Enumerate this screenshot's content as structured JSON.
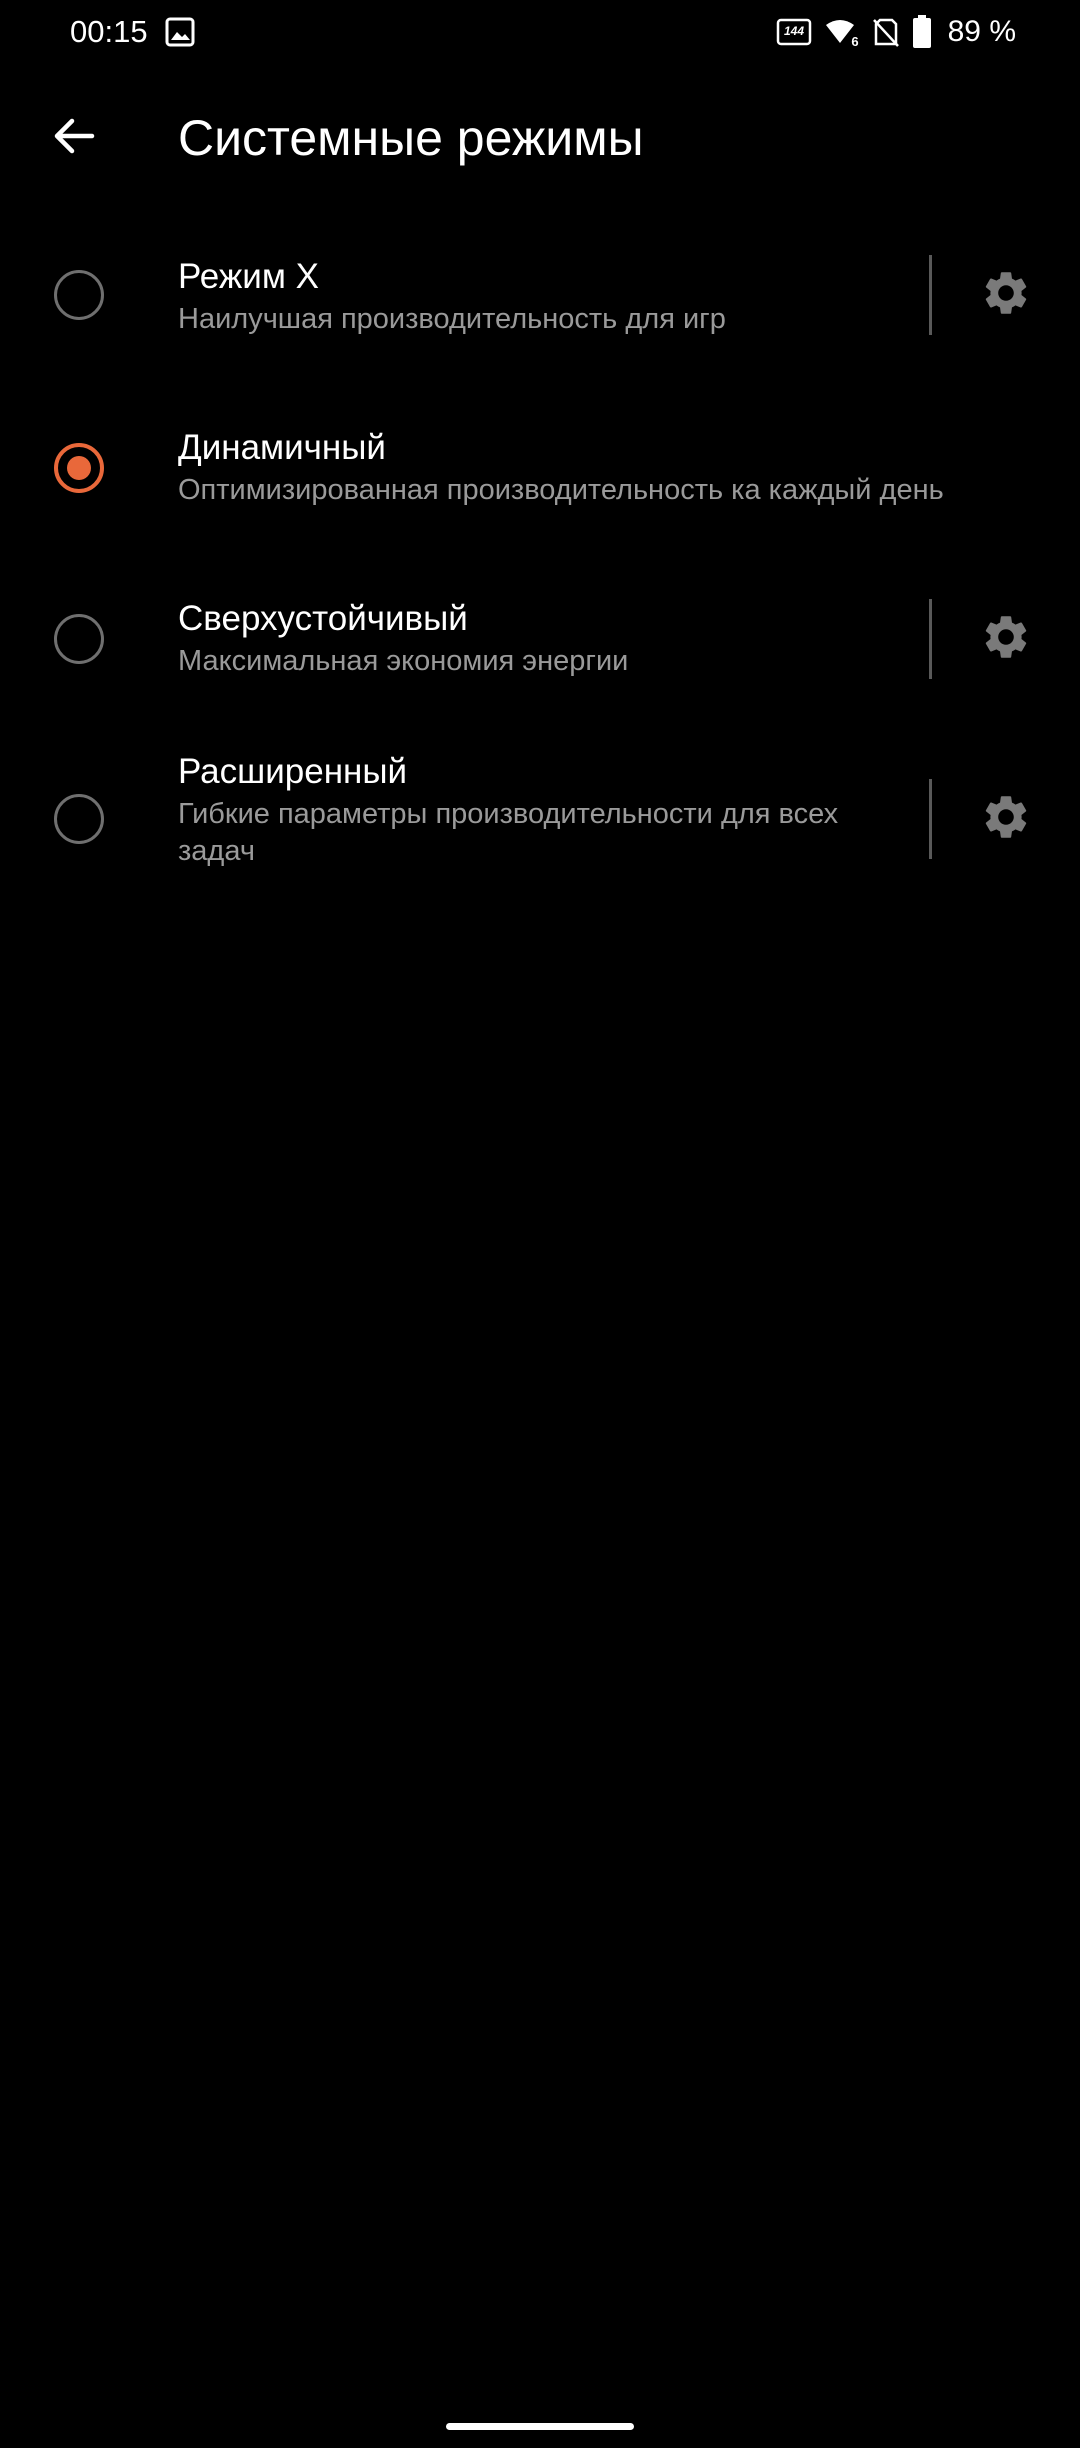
{
  "status_bar": {
    "time": "00:15",
    "battery_text": "89 %",
    "icons": [
      "gallery-icon",
      "refresh-rate-144hz-icon",
      "wifi-6-icon",
      "no-sim-icon",
      "battery-icon"
    ],
    "refresh_rate_label": "144",
    "wifi_label": "6"
  },
  "app_bar": {
    "title": "Системные режимы",
    "back_icon": "arrow-back-icon"
  },
  "modes": [
    {
      "title": "Режим X",
      "description": "Наилучшая производительность для игр",
      "selected": false,
      "has_settings": true
    },
    {
      "title": "Динамичный",
      "description": "Оптимизированная производительность ка каждый день",
      "selected": true,
      "has_settings": false
    },
    {
      "title": "Сверхустойчивый",
      "description": "Максимальная экономия энергии",
      "selected": false,
      "has_settings": true
    },
    {
      "title": "Расширенный",
      "description": "Гибкие параметры производительности для всех задач",
      "selected": false,
      "has_settings": true
    }
  ],
  "colors": {
    "background": "#000000",
    "accent": "#e9683a",
    "text_primary": "#ffffff",
    "text_secondary": "#9a9a9a",
    "divider": "#595959"
  }
}
